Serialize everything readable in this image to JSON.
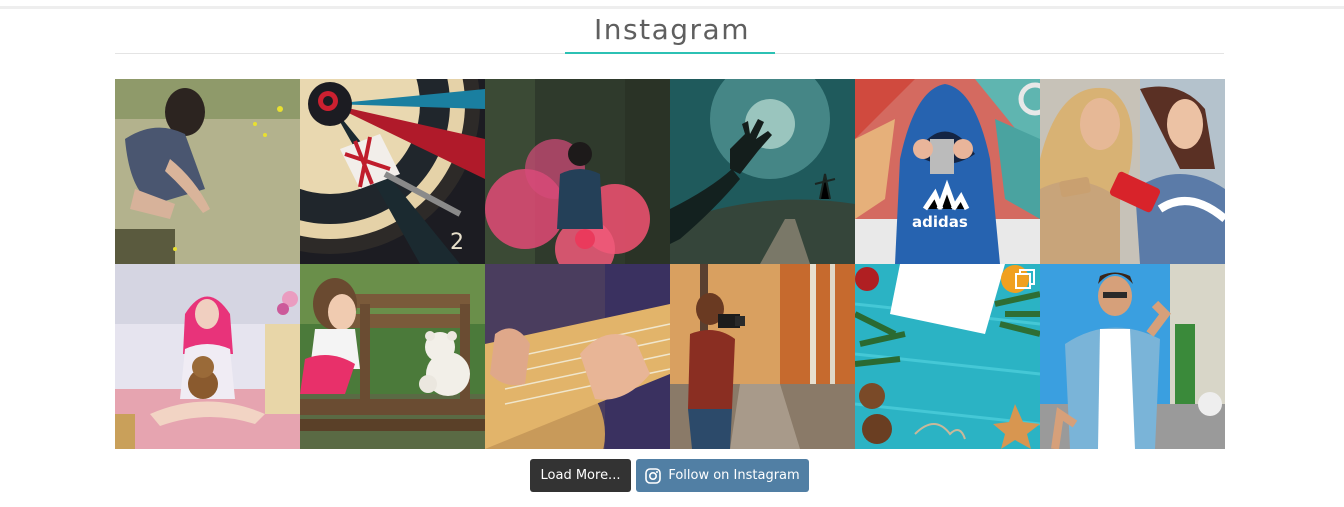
{
  "section": {
    "title": "Instagram"
  },
  "feed": {
    "photos": [
      {
        "alt": "Woman crouching at a pond"
      },
      {
        "alt": "Dart in a dartboard"
      },
      {
        "alt": "Woman in pink smoke in a forest"
      },
      {
        "alt": "Hand reaching toward the sky over a road"
      },
      {
        "alt": "Person in blue adidas hoodie"
      },
      {
        "alt": "Two women looking at phones"
      },
      {
        "alt": "Girl with pink hair and a teddy bear"
      },
      {
        "alt": "Little girl on a bench with a teddy bear"
      },
      {
        "alt": "Hands playing a ukulele"
      },
      {
        "alt": "Photographer in an autumn forest"
      },
      {
        "alt": "Christmas decorations on turquoise wood"
      },
      {
        "alt": "Smiling man in a blue jacket"
      }
    ]
  },
  "buttons": {
    "load_more": "Load More...",
    "follow": "Follow on Instagram"
  },
  "icons": {
    "multi_image": "multiple-images-icon",
    "instagram": "instagram-icon"
  },
  "colors": {
    "accent": "#2cc1b4",
    "load_button": "#333333",
    "follow_button": "#517fa4"
  }
}
